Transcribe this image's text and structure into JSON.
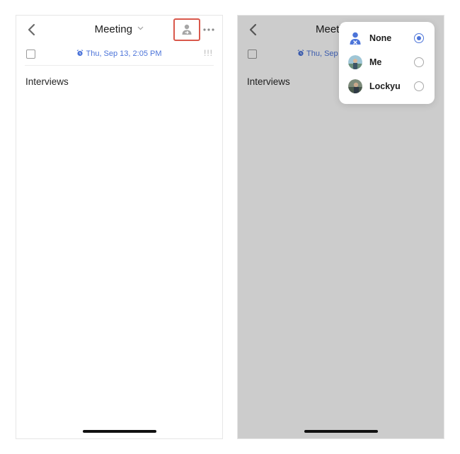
{
  "left_screen": {
    "title": "Meeting",
    "date_text": "Thu, Sep 13, 2:05 PM",
    "priority": "!!!",
    "content": "Interviews"
  },
  "right_screen": {
    "title": "Meeti",
    "date_text": "Thu, Sep",
    "content": "Interviews",
    "assignee_menu": {
      "options": [
        {
          "label": "None",
          "icon": "unassigned-person-icon",
          "selected": true
        },
        {
          "label": "Me",
          "icon": "avatar-me",
          "selected": false
        },
        {
          "label": "Lockyu",
          "icon": "avatar-lockyu",
          "selected": false
        }
      ]
    }
  },
  "colors": {
    "accent": "#4c74d9",
    "highlight_box": "#d9584b",
    "overlay": "rgba(0,0,0,0.2)"
  }
}
